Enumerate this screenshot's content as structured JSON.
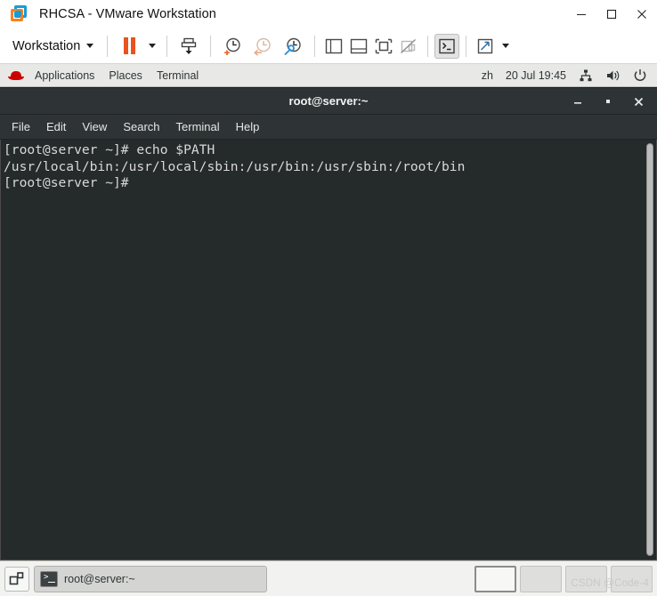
{
  "vmware": {
    "title": "RHCSA - VMware Workstation",
    "logo_icon": "vmware-logo-icon",
    "window_buttons": [
      {
        "name": "minimize",
        "label": "–",
        "icon": "minimize-icon"
      },
      {
        "name": "maximize",
        "label": "□",
        "icon": "maximize-icon"
      },
      {
        "name": "close",
        "label": "✕",
        "icon": "close-icon"
      }
    ],
    "toolbar": {
      "workstation_menu_label": "Workstation",
      "workstation_caret_icon": "chevron-down-icon",
      "buttons": [
        {
          "name": "suspend-button",
          "icon": "pause-icon"
        },
        {
          "name": "suspend-dropdown",
          "icon": "chevron-down-icon"
        },
        {
          "name": "power-button",
          "icon": "power-vm-icon"
        },
        {
          "name": "take-snapshot-button",
          "icon": "snapshot-add-icon"
        },
        {
          "name": "revert-snapshot-button",
          "icon": "snapshot-revert-icon"
        },
        {
          "name": "manage-snapshots-button",
          "icon": "snapshot-manager-icon"
        },
        {
          "name": "show-sidebar-button",
          "icon": "panel-left-icon"
        },
        {
          "name": "show-thumbnails-button",
          "icon": "panel-bottom-icon"
        },
        {
          "name": "fullscreen-button",
          "icon": "fullscreen-icon"
        },
        {
          "name": "unity-mode-button",
          "icon": "unity-disabled-icon"
        },
        {
          "name": "console-view-button",
          "icon": "console-prompt-icon"
        },
        {
          "name": "stretch-guest-button",
          "icon": "expand-arrows-icon"
        },
        {
          "name": "stretch-dropdown",
          "icon": "chevron-down-icon"
        }
      ]
    }
  },
  "gnome": {
    "topbar": {
      "redhat_icon": "redhat-logo-icon",
      "menus": [
        {
          "name": "applications",
          "label": "Applications"
        },
        {
          "name": "places",
          "label": "Places"
        },
        {
          "name": "terminal",
          "label": "Terminal"
        }
      ],
      "keyboard_layout": "zh",
      "clock": "20 Jul  19:45",
      "status_icons": [
        {
          "name": "network-wired-icon",
          "label": "network"
        },
        {
          "name": "volume-icon",
          "label": "volume"
        },
        {
          "name": "power-icon",
          "label": "power"
        }
      ]
    },
    "taskbar": {
      "show_desktop_icon": "show-desktop-icon",
      "task": {
        "icon": "terminal-icon",
        "label": "root@server:~"
      },
      "workspaces": [
        {
          "name": "workspace-1",
          "active": true
        },
        {
          "name": "workspace-2",
          "active": false
        },
        {
          "name": "workspace-3",
          "active": false
        },
        {
          "name": "workspace-4",
          "active": false
        }
      ],
      "watermark": "CSDN @Code-4"
    }
  },
  "terminal": {
    "title": "root@server:~",
    "window_buttons": [
      {
        "name": "minimize",
        "label": "–"
      },
      {
        "name": "maximize",
        "label": "▪"
      },
      {
        "name": "close",
        "label": "✕"
      }
    ],
    "menubar": [
      {
        "name": "file",
        "label": "File"
      },
      {
        "name": "edit",
        "label": "Edit"
      },
      {
        "name": "view",
        "label": "View"
      },
      {
        "name": "search",
        "label": "Search"
      },
      {
        "name": "terminal",
        "label": "Terminal"
      },
      {
        "name": "help",
        "label": "Help"
      }
    ],
    "content": "[root@server ~]# echo $PATH\n/usr/local/bin:/usr/local/sbin:/usr/bin:/usr/sbin:/root/bin\n[root@server ~]# ",
    "colors": {
      "background": "#252a2b",
      "foreground": "#d8d8d8",
      "titlebar": "#2e3436"
    }
  }
}
